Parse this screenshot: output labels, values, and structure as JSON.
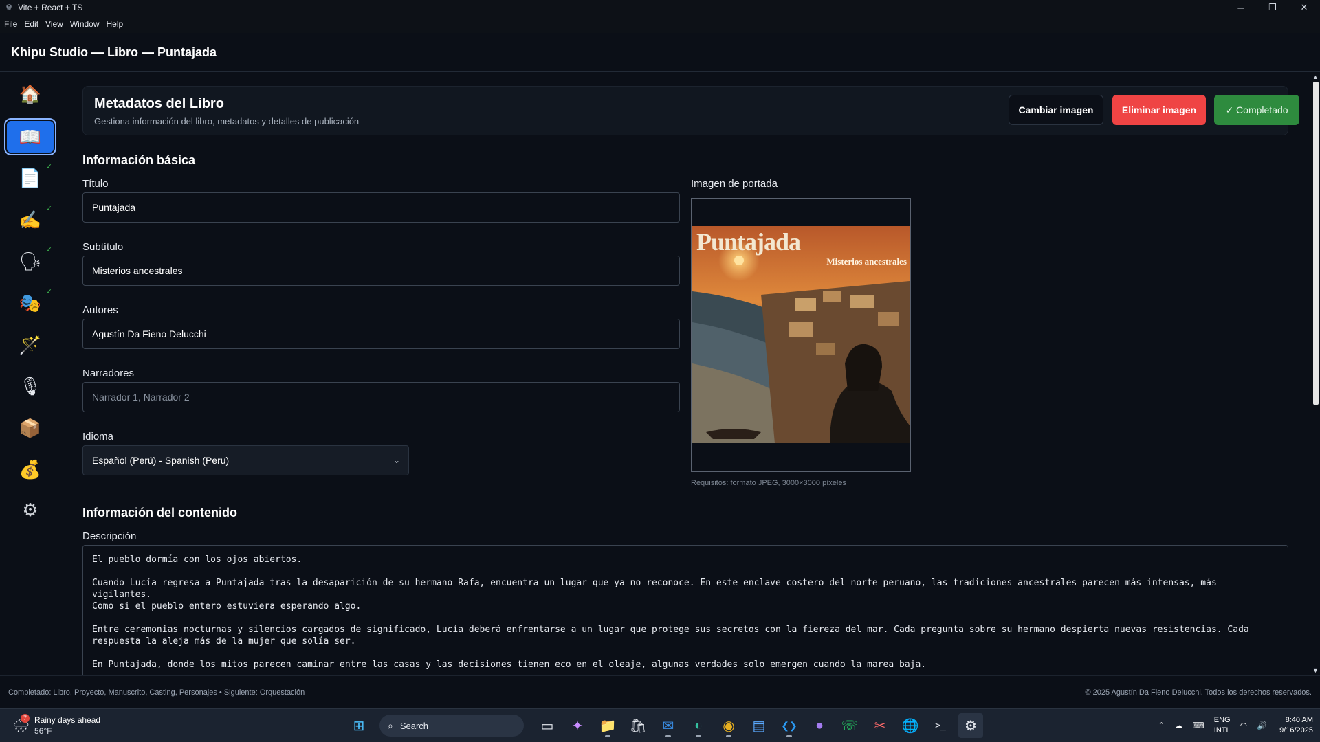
{
  "window": {
    "title": "Vite + React + TS",
    "controls": {
      "minimize": "─",
      "restore": "❐",
      "close": "✕"
    }
  },
  "menu": [
    "File",
    "Edit",
    "View",
    "Window",
    "Help"
  ],
  "header": {
    "title": "Khipu Studio — Libro — Puntajada"
  },
  "sidebar": {
    "items": [
      {
        "icon": "house-icon",
        "glyph": "🏠",
        "completed": false,
        "active": false
      },
      {
        "icon": "book-icon",
        "glyph": "📖",
        "completed": false,
        "active": true
      },
      {
        "icon": "document-icon",
        "glyph": "📄",
        "completed": true,
        "active": false
      },
      {
        "icon": "writing-hand-icon",
        "glyph": "✍",
        "completed": true,
        "active": false
      },
      {
        "icon": "speaking-head-icon",
        "glyph": "🗣",
        "completed": true,
        "active": false
      },
      {
        "icon": "theater-masks-icon",
        "glyph": "🎭",
        "completed": true,
        "active": false
      },
      {
        "icon": "magic-wand-icon",
        "glyph": "🪄",
        "completed": false,
        "active": false
      },
      {
        "icon": "microphone-icon",
        "glyph": "🎙",
        "completed": false,
        "active": false
      },
      {
        "icon": "package-icon",
        "glyph": "📦",
        "completed": false,
        "active": false
      },
      {
        "icon": "money-bag-icon",
        "glyph": "💰",
        "completed": false,
        "active": false
      },
      {
        "icon": "gear-icon",
        "glyph": "⚙",
        "completed": false,
        "active": false
      }
    ],
    "check_glyph": "✓"
  },
  "panel": {
    "title": "Metadatos del Libro",
    "subtitle": "Gestiona información del libro, metadatos y detalles de publicación",
    "buttons": {
      "change_image": "Cambiar imagen",
      "delete_image": "Eliminar imagen",
      "completed": "✓ Completado"
    }
  },
  "basic": {
    "section_title": "Información básica",
    "title_label": "Título",
    "title_value": "Puntajada",
    "subtitle_label": "Subtítulo",
    "subtitle_value": "Misterios ancestrales",
    "authors_label": "Autores",
    "authors_value": "Agustín Da Fieno Delucchi",
    "narrators_label": "Narradores",
    "narrators_placeholder": "Narrador 1, Narrador 2",
    "language_label": "Idioma",
    "language_value": "Español (Perú) - Spanish (Peru)"
  },
  "cover": {
    "label": "Imagen de portada",
    "image_title": "Puntajada",
    "image_subtitle": "Misterios ancestrales",
    "requirements": "Requisitos: formato JPEG, 3000×3000 píxeles"
  },
  "content": {
    "section_title": "Información del contenido",
    "description_label": "Descripción",
    "description_paragraphs": [
      "El pueblo dormía con los ojos abiertos.",
      "Cuando Lucía regresa a Puntajada tras la desaparición de su hermano Rafa, encuentra un lugar que ya no reconoce. En este enclave costero del norte peruano, las tradiciones ancestrales parecen más intensas, más vigilantes.\nComo si el pueblo entero estuviera esperando algo.",
      "Entre ceremonias nocturnas y silencios cargados de significado, Lucía deberá enfrentarse a un lugar que protege sus secretos con la fiereza del mar. Cada pregunta sobre su hermano despierta nuevas resistencias. Cada\nrespuesta la aleja más de la mujer que solía ser.",
      "En Puntajada, donde los mitos parecen caminar entre las casas y las decisiones tienen eco en el oleaje, algunas verdades solo emergen cuando la marea baja."
    ]
  },
  "footer": {
    "status": "Completado: Libro, Proyecto, Manuscrito, Casting, Personajes • Siguiente: Orquestación",
    "copyright": "© 2025 Agustín Da Fieno Delucchi. Todos los derechos reservados."
  },
  "taskbar": {
    "weather_badge": "7",
    "weather_line1": "Rainy days ahead",
    "weather_line2": "56°F",
    "search_label": "Search",
    "apps": [
      {
        "icon": "windows-start-icon",
        "glyph": "⊞",
        "state": ""
      },
      {
        "icon": "task-view-icon",
        "glyph": "▭",
        "state": ""
      },
      {
        "icon": "copilot-icon",
        "glyph": "✦",
        "state": ""
      },
      {
        "icon": "file-explorer-icon",
        "glyph": "📁",
        "state": "running"
      },
      {
        "icon": "store-icon",
        "glyph": "🛍",
        "state": ""
      },
      {
        "icon": "outlook-icon",
        "glyph": "✉",
        "state": "running"
      },
      {
        "icon": "edge-icon",
        "glyph": "◐",
        "state": "running"
      },
      {
        "icon": "chrome-icon",
        "glyph": "◉",
        "state": "running"
      },
      {
        "icon": "notepad-icon",
        "glyph": "▤",
        "state": ""
      },
      {
        "icon": "vscode-icon",
        "glyph": "❮❯",
        "state": "running"
      },
      {
        "icon": "github-icon",
        "glyph": "●",
        "state": ""
      },
      {
        "icon": "whatsapp-icon",
        "glyph": "☏",
        "state": ""
      },
      {
        "icon": "snipping-tool-icon",
        "glyph": "✂",
        "state": ""
      },
      {
        "icon": "globe-app-icon",
        "glyph": "🌐",
        "state": ""
      },
      {
        "icon": "terminal-icon",
        "glyph": ">_",
        "state": ""
      },
      {
        "icon": "app-gear-icon",
        "glyph": "⚙",
        "state": "active"
      }
    ],
    "lang_line1": "ENG",
    "lang_line2": "INTL",
    "time": "8:40 AM",
    "date": "9/16/2025"
  },
  "colors": {
    "accent": "#1f6feb",
    "danger": "#ef4444",
    "success": "#2e8b3e",
    "check": "#3fb950"
  }
}
